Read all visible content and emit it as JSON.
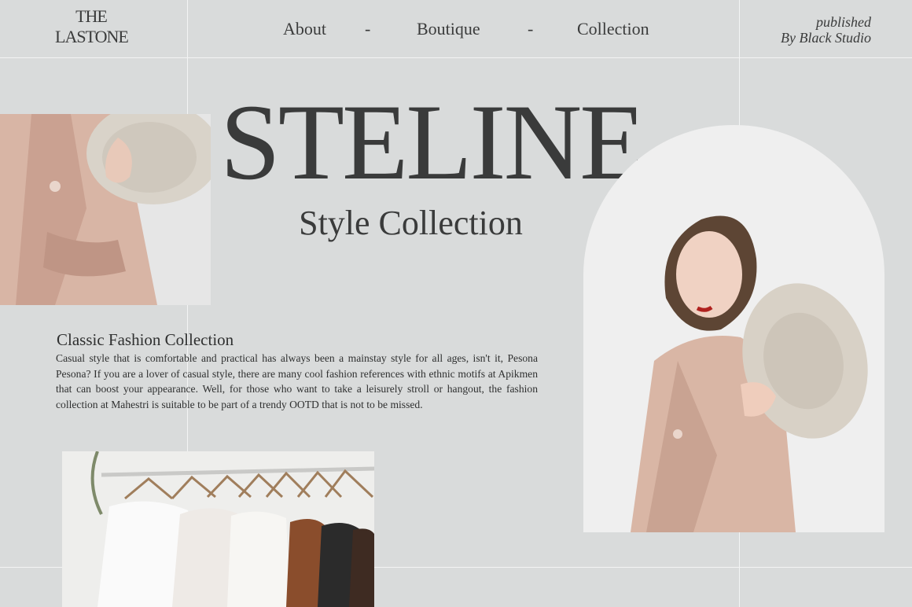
{
  "logo": {
    "line1": "THE",
    "line2": "LASTONE"
  },
  "nav": {
    "items": [
      {
        "label": "About"
      },
      {
        "label": "Boutique"
      },
      {
        "label": "Collection"
      }
    ],
    "separator": "-"
  },
  "published": {
    "line1": "published",
    "line2": "By Black Studio"
  },
  "hero": {
    "title": "STELINE",
    "subtitle": "Style Collection"
  },
  "section": {
    "heading": "Classic Fashion Collection",
    "body": "Casual style that is comfortable and practical has always been a mainstay style for all ages, isn't it, Pesona Pesona? If you are a lover of casual style, there are many cool fashion references with ethnic motifs at Apikmen that can boost your appearance. Well, for those who want to take a leisurely stroll or hangout, the fashion collection at Mahestri is suitable to be part of a trendy OOTD that is not to be missed."
  },
  "colors": {
    "background": "#d9dbdb",
    "gridline": "#f3f4f4",
    "text": "#3a3b3b",
    "coat": "#d9b8aa",
    "hat": "#d8d2c8"
  }
}
